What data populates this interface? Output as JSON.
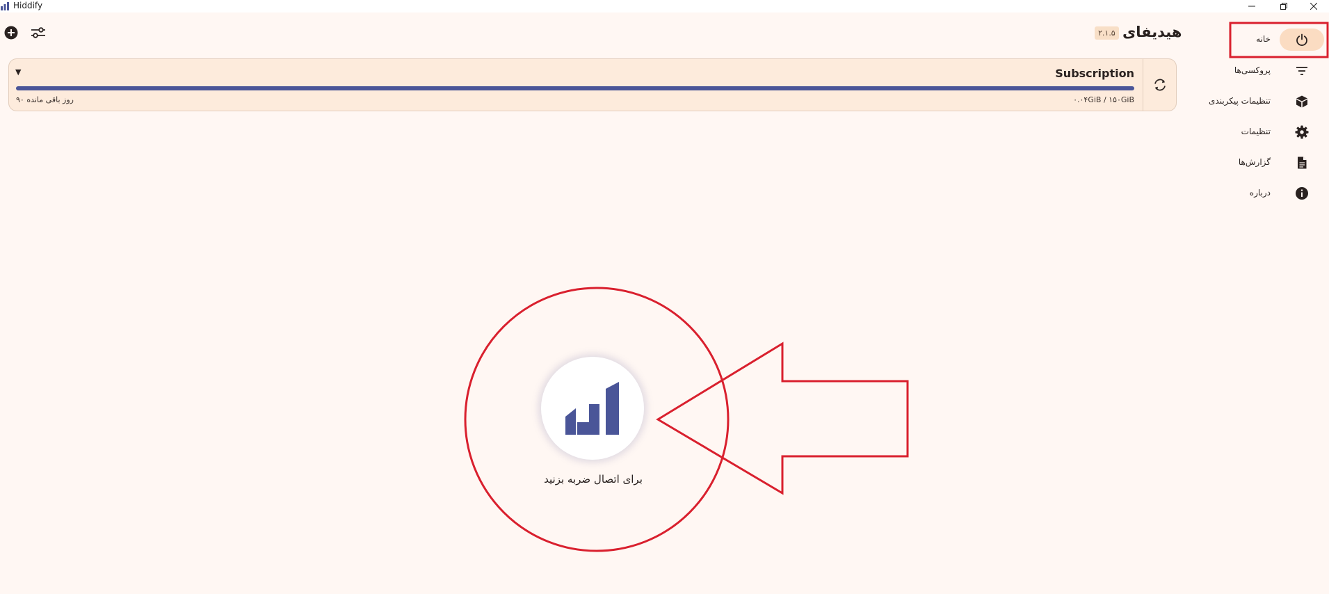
{
  "window": {
    "title": "Hiddify",
    "controls": [
      "minimize",
      "restore",
      "close"
    ]
  },
  "sidebar": {
    "items": [
      {
        "label": "خانه",
        "icon": "power-icon",
        "active": true
      },
      {
        "label": "پروکسی‌ها",
        "icon": "filter-lines-icon"
      },
      {
        "label": "تنظیمات پیکربندی",
        "icon": "package-icon"
      },
      {
        "label": "تنظیمات",
        "icon": "gear-icon"
      },
      {
        "label": "گزارش‌ها",
        "icon": "document-icon"
      },
      {
        "label": "درباره",
        "icon": "info-icon"
      }
    ]
  },
  "header": {
    "app_name": "هیدیفای",
    "version": "۲.۱.۵"
  },
  "subscription": {
    "name": "Subscription",
    "usage": "۰.۰۴GiB / ۱۵۰GiB",
    "days_left": "۹۰ روز باقی مانده",
    "progress_fraction": 1.0
  },
  "connect": {
    "hint": "برای اتصال ضربه بزنید"
  },
  "colors": {
    "background": "#fff7f3",
    "card": "#fdebdc",
    "accent": "#4a5598",
    "active_pill": "#fbdcc2",
    "annotation": "#d9202e"
  }
}
